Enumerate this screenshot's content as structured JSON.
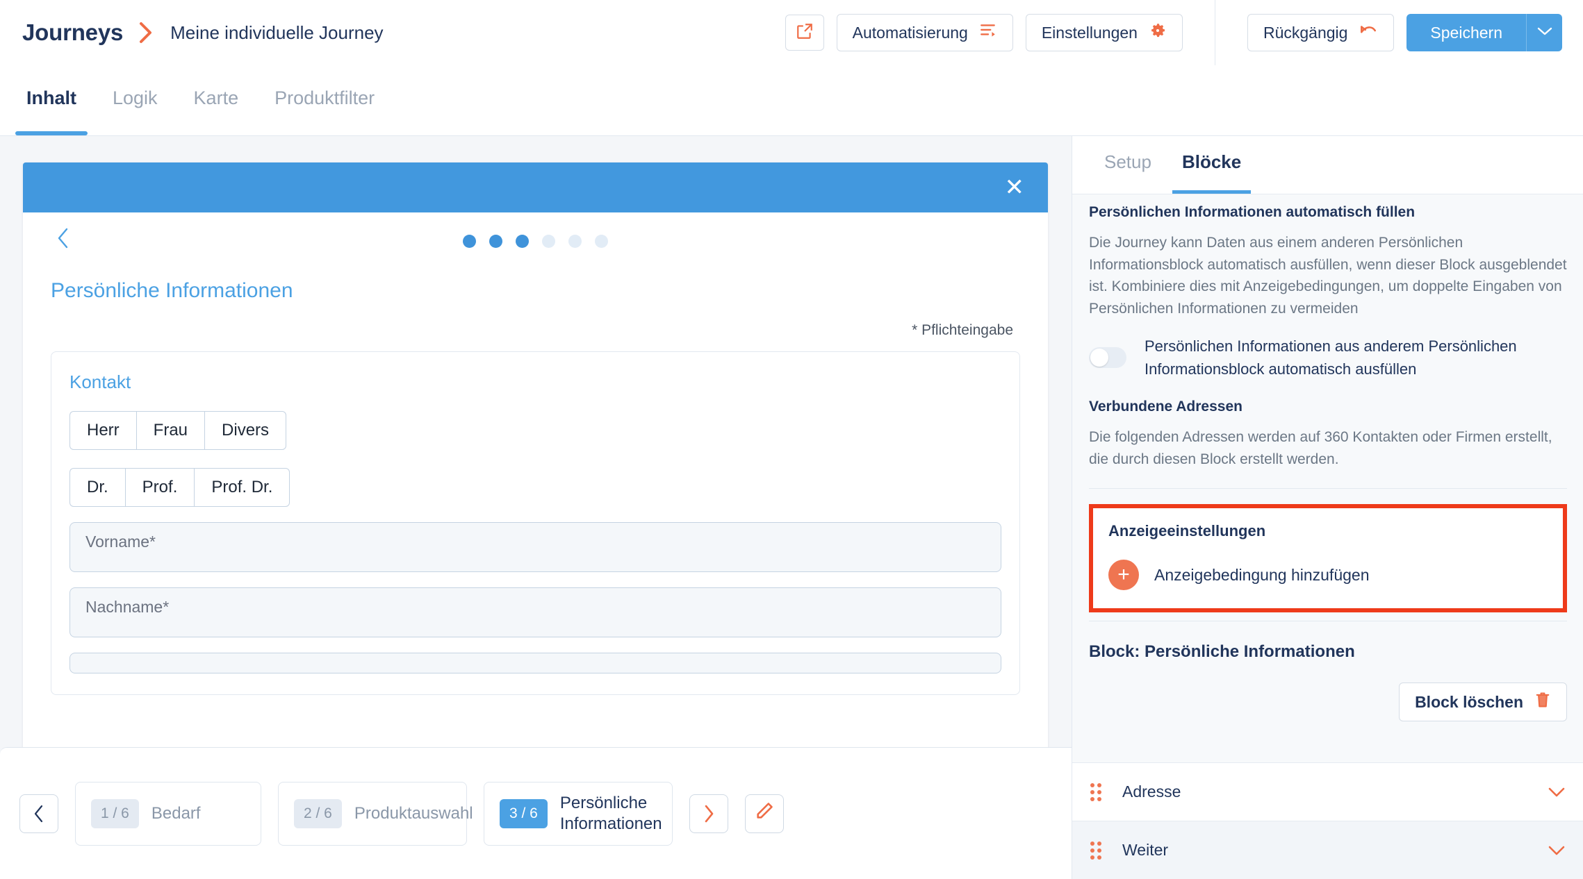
{
  "header": {
    "brand": "Journeys",
    "breadcrumb_icon": "chevron-right-icon",
    "journey_title": "Meine individuelle Journey",
    "external_link_icon": "external-link-icon",
    "automation_label": "Automatisierung",
    "automation_icon": "automation-list-icon",
    "settings_label": "Einstellungen",
    "settings_icon": "gear-icon",
    "undo_label": "Rückgängig",
    "undo_icon": "undo-arrow-icon",
    "save_label": "Speichern",
    "save_caret_icon": "chevron-down-icon"
  },
  "tabs": [
    {
      "label": "Inhalt",
      "active": true
    },
    {
      "label": "Logik",
      "active": false
    },
    {
      "label": "Karte",
      "active": false
    },
    {
      "label": "Produktfilter",
      "active": false
    }
  ],
  "preview": {
    "close_icon": "close-icon",
    "carousel_prev_icon": "chevron-left-icon",
    "dots_total": 6,
    "dots_filled": 3,
    "form_title": "Persönliche Informationen",
    "required_note": "* Pflichteingabe",
    "fieldset_title": "Kontakt",
    "salutations": [
      "Herr",
      "Frau",
      "Divers"
    ],
    "titles": [
      "Dr.",
      "Prof.",
      "Prof. Dr."
    ],
    "fields": [
      {
        "placeholder": "Vorname*"
      },
      {
        "placeholder": "Nachname*"
      }
    ]
  },
  "stepbar": {
    "prev_icon": "chevron-left-icon",
    "next_icon": "chevron-right-icon",
    "edit_icon": "pencil-icon",
    "steps": [
      {
        "badge": "1 / 6",
        "label": "Bedarf",
        "active": false
      },
      {
        "badge": "2 / 6",
        "label": "Produktauswahl",
        "active": false
      },
      {
        "badge": "3 / 6",
        "label": "Persönliche Informationen",
        "active": true
      }
    ]
  },
  "right_panel": {
    "tabs": [
      {
        "label": "Setup",
        "active": false
      },
      {
        "label": "Blöcke",
        "active": true
      }
    ],
    "autofill": {
      "heading": "Persönlichen Informationen automatisch füllen",
      "description": "Die Journey kann Daten aus einem anderen Persönlichen Informationsblock automatisch ausfüllen, wenn dieser Block ausgeblendet ist. Kombiniere dies mit Anzeigebedingungen, um doppelte Eingaben von Persönlichen Informationen zu vermeiden",
      "toggle_label": "Persönlichen Informationen aus anderem Persönlichen Informationsblock automatisch ausfüllen",
      "toggle_on": false
    },
    "linked_addresses": {
      "heading": "Verbundene Adressen",
      "description": "Die folgenden Adressen werden auf 360 Kontakten oder Firmen erstellt, die durch diesen Block erstellt werden."
    },
    "display_settings": {
      "heading": "Anzeigeeinstellungen",
      "add_icon": "plus-circle-icon",
      "add_label": "Anzeigebedingung hinzufügen",
      "highlight_color": "#ee3a1a"
    },
    "block_title": "Block: Persönliche Informationen",
    "delete_label": "Block löschen",
    "delete_icon": "trash-icon",
    "block_list": [
      {
        "name": "Adresse",
        "grip_icon": "drag-handle-icon",
        "chevron_icon": "chevron-down-icon"
      },
      {
        "name": "Weiter",
        "grip_icon": "drag-handle-icon",
        "chevron_icon": "chevron-down-icon"
      }
    ]
  },
  "colors": {
    "brand_navy": "#21355b",
    "accent_blue": "#4ba1e3",
    "accent_orange": "#ef7551",
    "highlight_red": "#ee3a1a",
    "page_bg": "#f4f6f9"
  }
}
